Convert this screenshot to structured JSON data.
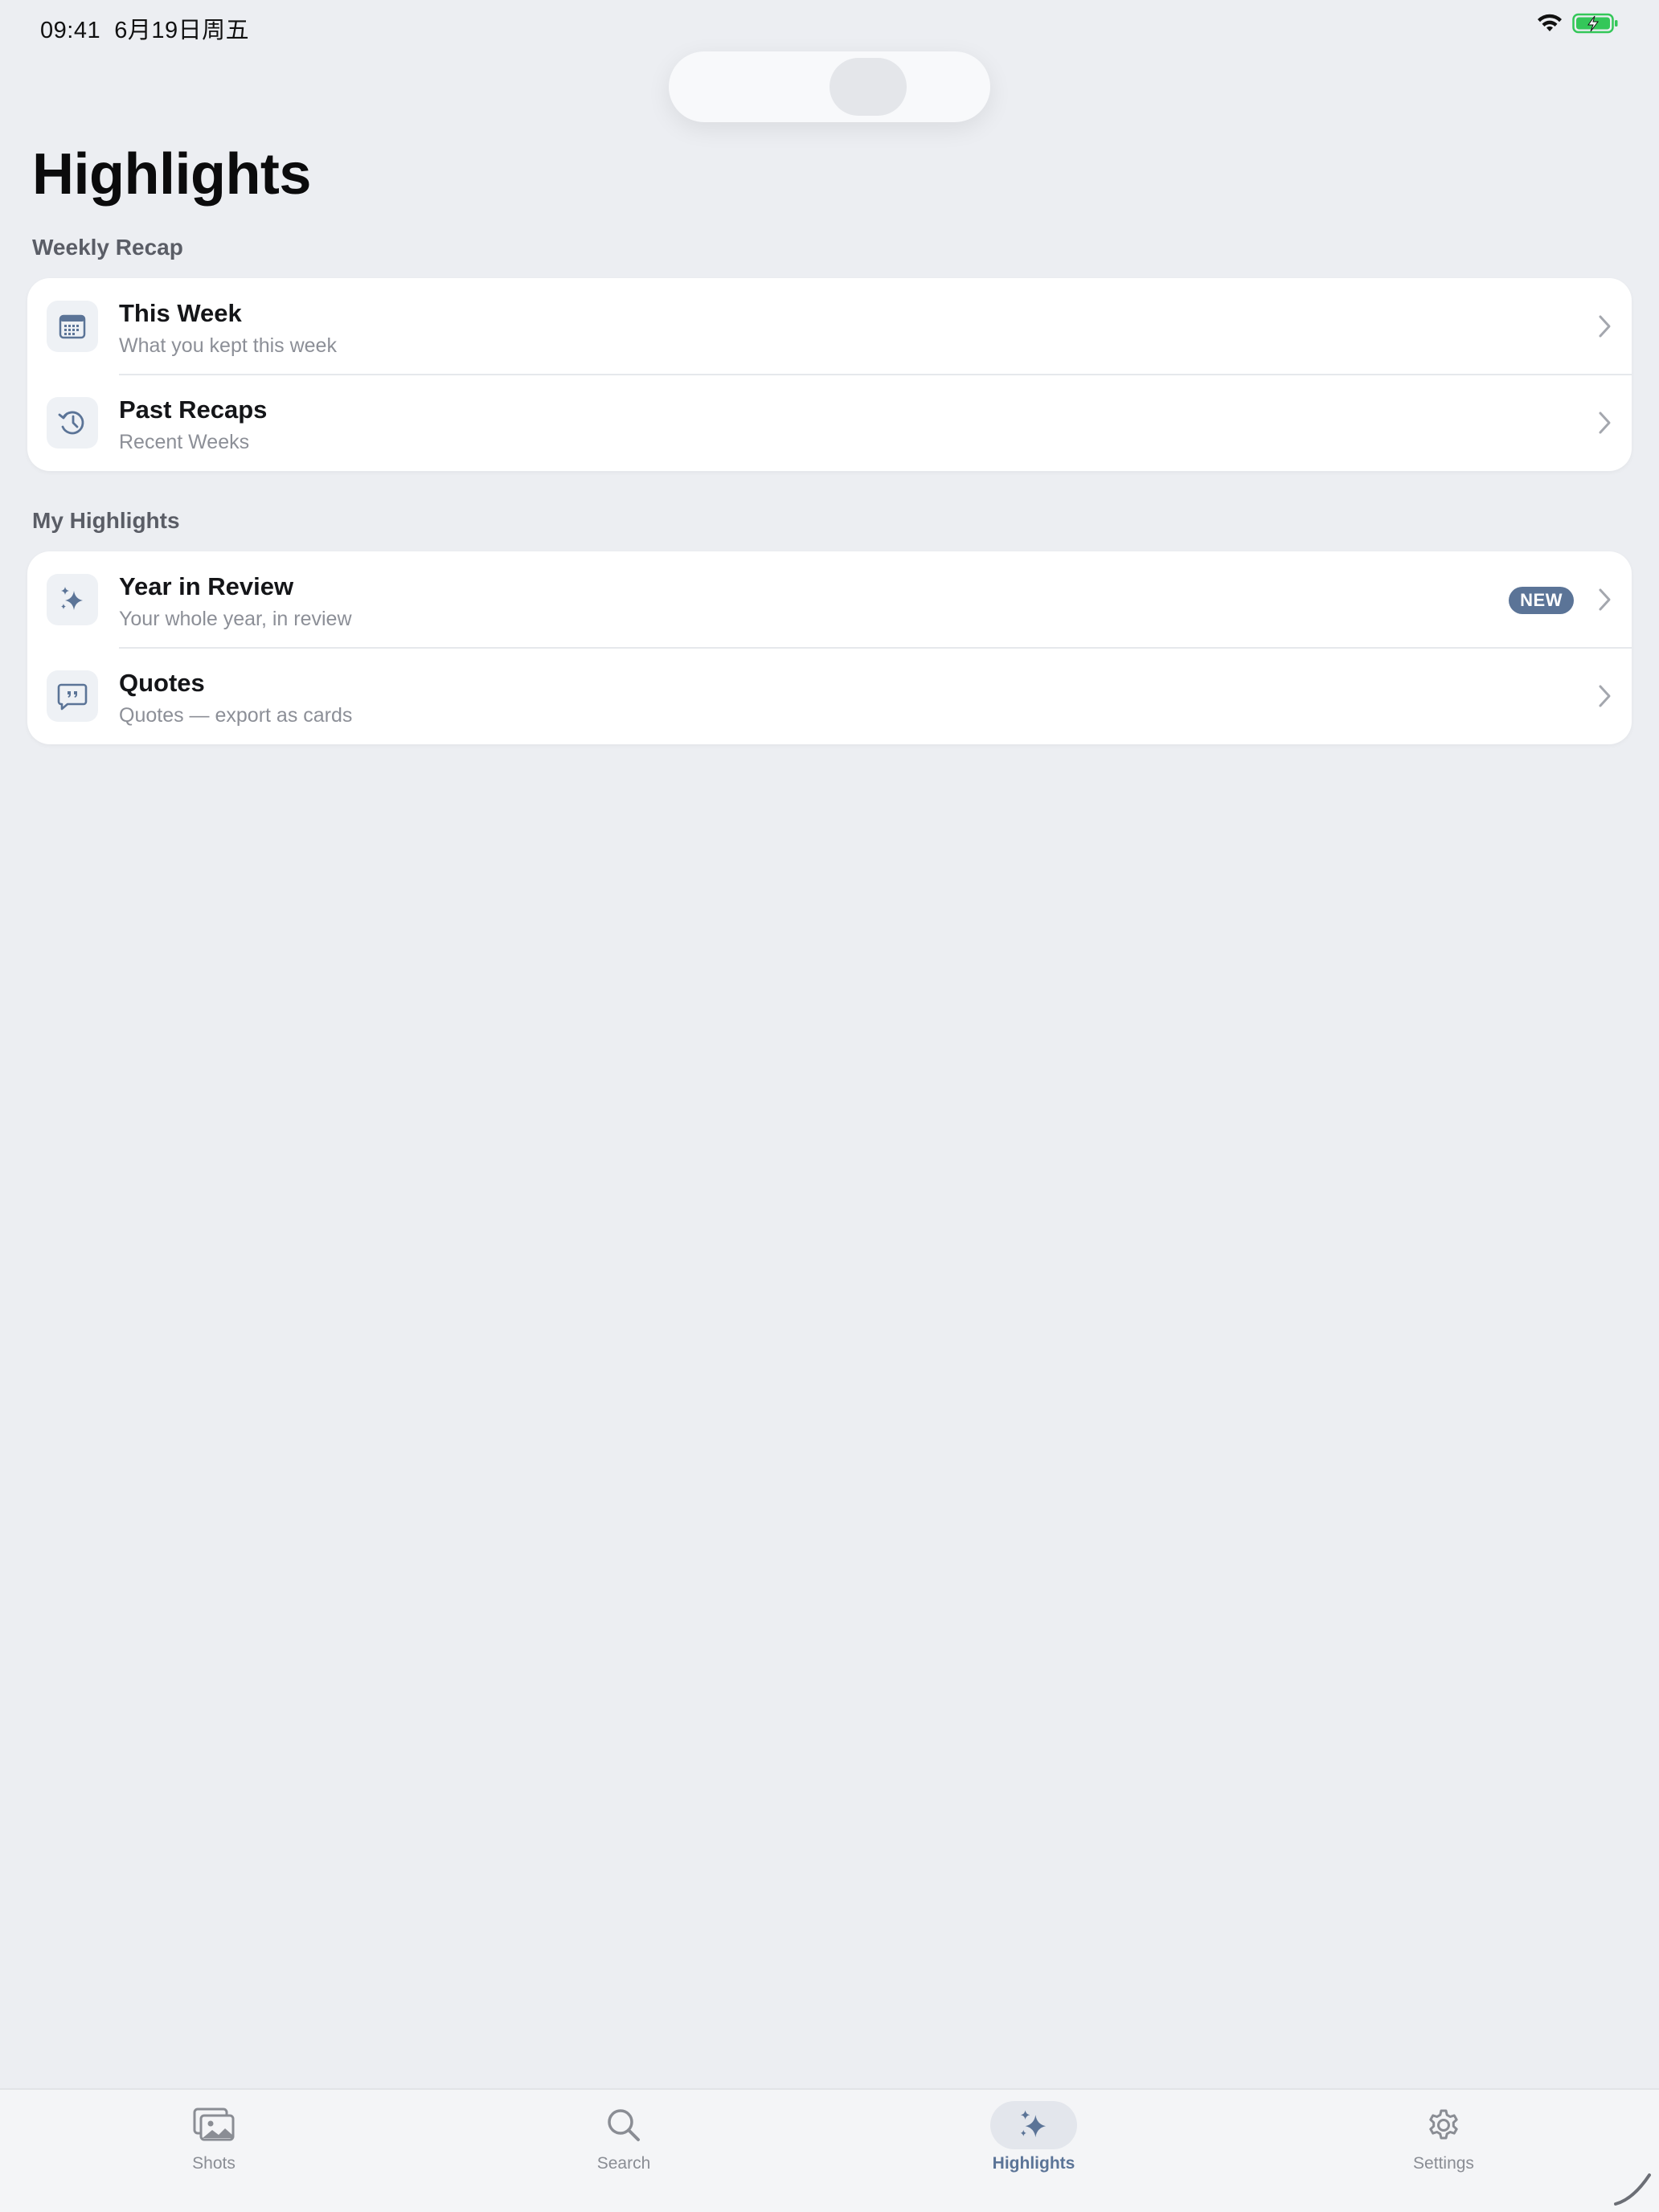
{
  "status_bar": {
    "time": "09:41",
    "date": "6月19日周五",
    "icons": [
      "wifi-icon",
      "battery-charging-icon"
    ],
    "battery_color": "#34c759"
  },
  "page": {
    "title": "Highlights"
  },
  "sections": [
    {
      "header": "Weekly Recap",
      "rows": [
        {
          "icon": "calendar-icon",
          "title": "This Week",
          "subtitle": "What you kept this week"
        },
        {
          "icon": "history-icon",
          "title": "Past Recaps",
          "subtitle": "Recent Weeks"
        }
      ]
    },
    {
      "header": "My Highlights",
      "rows": [
        {
          "icon": "sparkles-icon",
          "title": "Year in Review",
          "subtitle": "Your whole year, in review",
          "badge": "NEW"
        },
        {
          "icon": "quote-bubble-icon",
          "title": "Quotes",
          "subtitle": "Quotes — export as cards"
        }
      ]
    }
  ],
  "tab_bar": {
    "tabs": [
      {
        "label": "Shots",
        "icon": "photos-icon",
        "active": false
      },
      {
        "label": "Search",
        "icon": "search-icon",
        "active": false
      },
      {
        "label": "Highlights",
        "icon": "sparkles-icon",
        "active": true
      },
      {
        "label": "Settings",
        "icon": "gear-icon",
        "active": false
      }
    ]
  },
  "colors": {
    "accent": "#5b7497",
    "background": "#eceef2",
    "card": "#ffffff",
    "secondary_text": "#8c8f97"
  }
}
